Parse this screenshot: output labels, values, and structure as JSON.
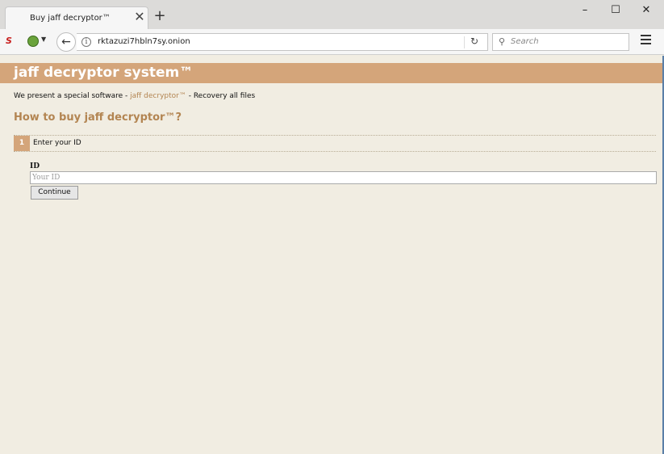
{
  "browser": {
    "tab_title": "Buy jaff decryptor™",
    "tab_close_glyph": "✕",
    "new_tab_glyph": "+",
    "window_minimize_glyph": "–",
    "window_maximize_glyph": "☐",
    "window_close_glyph": "✕",
    "extension_label": "S",
    "url": "rktazuzi7hbln7sy.onion",
    "search_placeholder": "Search",
    "icons": [
      "back-arrow-icon",
      "info-icon",
      "reload-icon",
      "search-icon",
      "hamburger-menu-icon",
      "onion-icon"
    ]
  },
  "page": {
    "site_title": "jaff decryptor system™",
    "intro_prefix": "We present a special software - ",
    "intro_highlight": "jaff decryptor™",
    "intro_suffix": " - Recovery all files",
    "how_title": "How to buy jaff decryptor™?",
    "step_number": "1",
    "step_label": "Enter your ID",
    "id_label": "ID",
    "id_placeholder": "Your ID",
    "continue_label": "Continue"
  },
  "colors": {
    "accent": "#d4a57a",
    "link": "#b38552",
    "background": "#f1ede2"
  }
}
